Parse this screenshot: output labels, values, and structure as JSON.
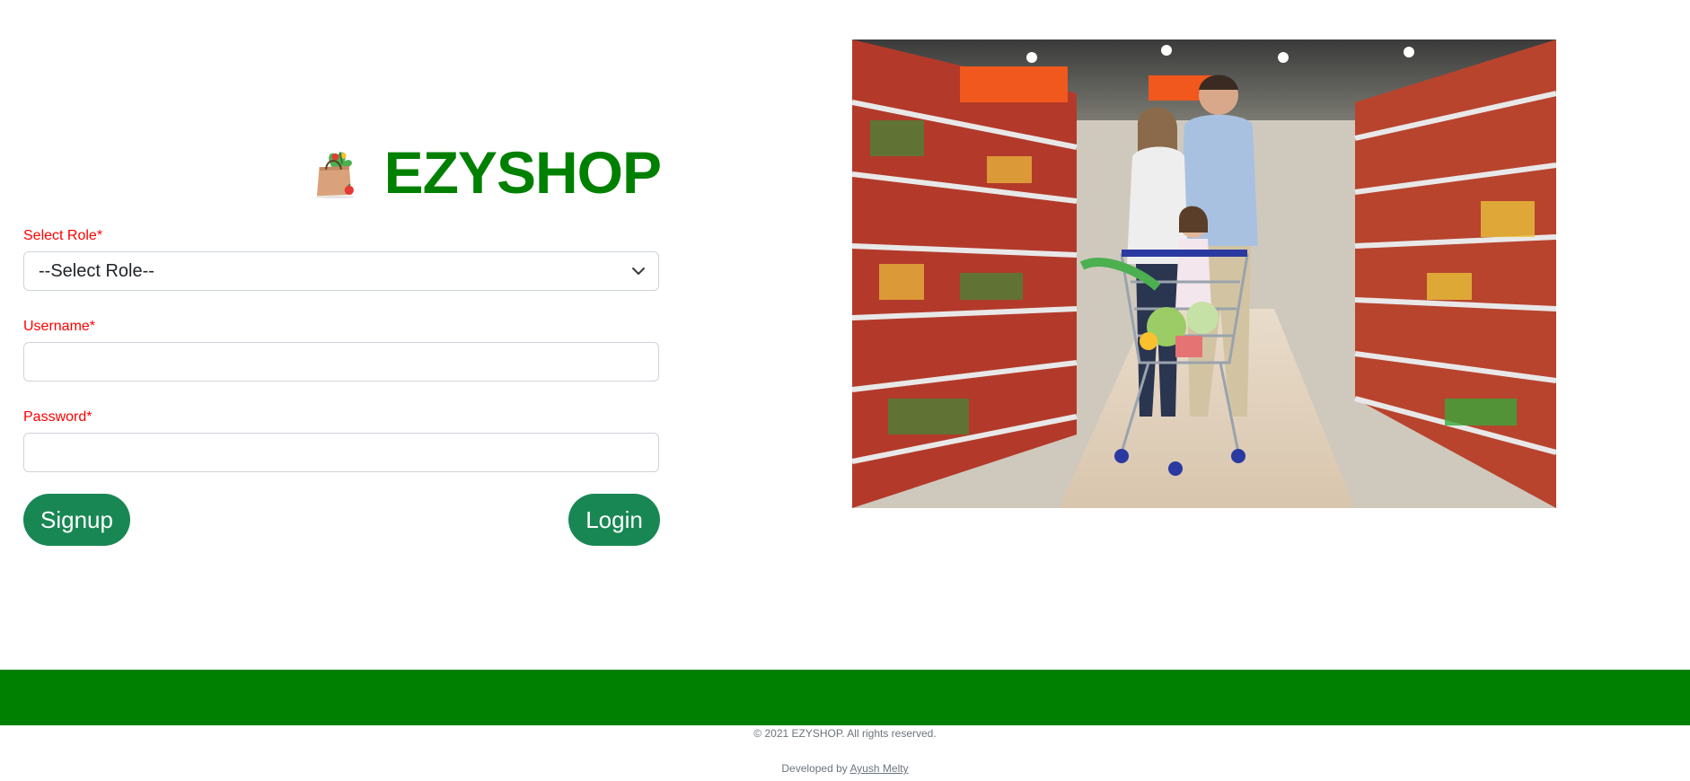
{
  "brand": {
    "name": "EZYSHOP",
    "logo_icon": "grocery-bag-icon",
    "color": "#008000"
  },
  "form": {
    "role": {
      "label": "Select Role*",
      "selected": "--Select Role--"
    },
    "username": {
      "label": "Username*",
      "value": "",
      "placeholder": ""
    },
    "password": {
      "label": "Password*",
      "value": "",
      "placeholder": ""
    },
    "label_color": "#ff0000"
  },
  "buttons": {
    "signup": "Signup",
    "login": "Login",
    "color": "#198754"
  },
  "hero": {
    "icon": "family-shopping-photo"
  },
  "footer": {
    "bar_color": "#008000",
    "copyright": "© 2021 EZYSHOP. All rights reserved.",
    "developed_prefix": "Developed by",
    "developer_name": "Ayush Melty"
  }
}
